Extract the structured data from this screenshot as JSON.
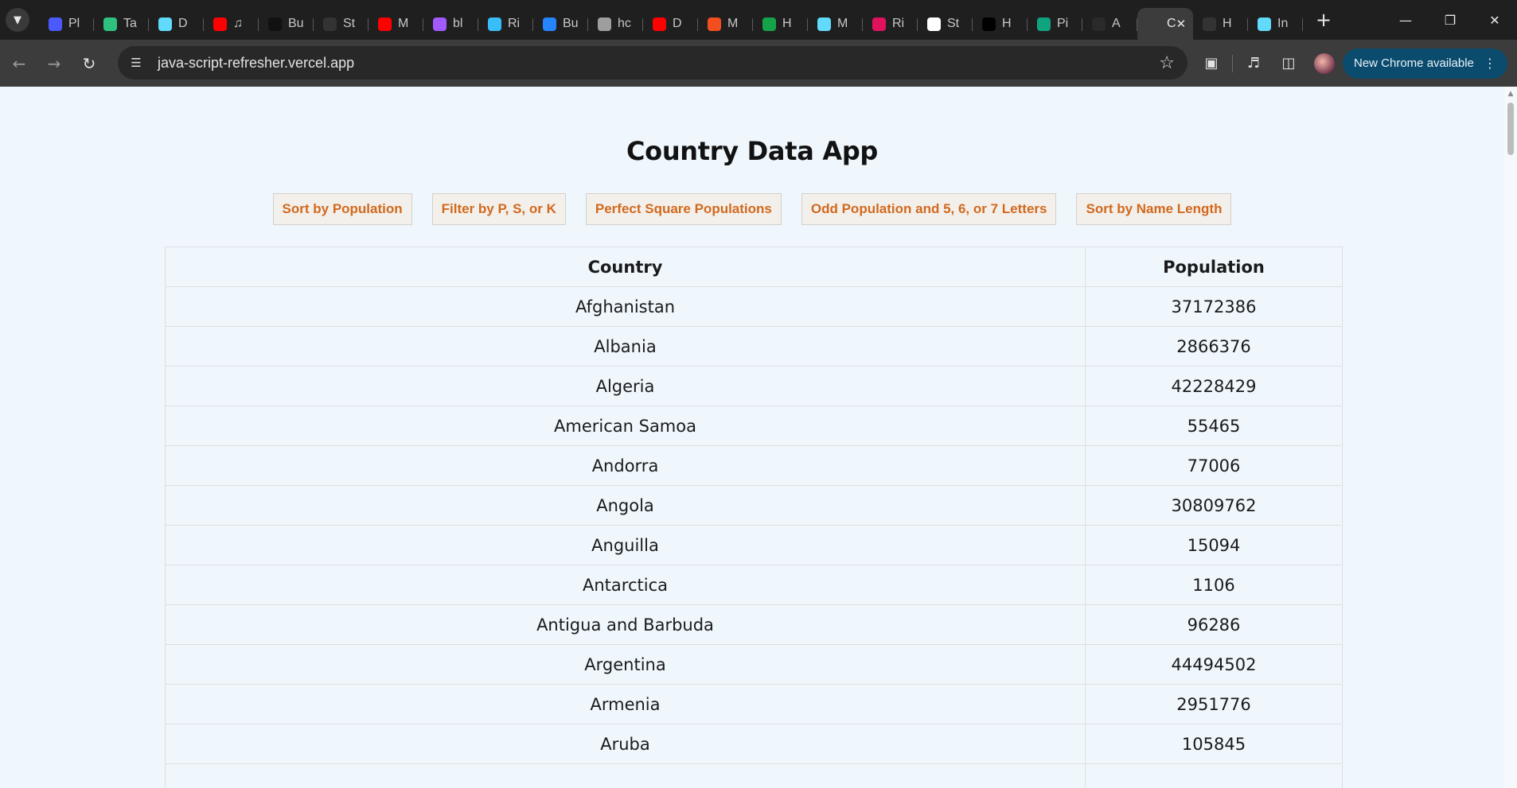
{
  "browser": {
    "tabs": [
      {
        "label": "Pl",
        "icon": "b-circle-icon",
        "color": "#4a5aff"
      },
      {
        "label": "Ta",
        "icon": "leaf-icon",
        "color": "#2ec27e"
      },
      {
        "label": "D",
        "icon": "react-icon",
        "color": "#61dafb"
      },
      {
        "label": "♫",
        "icon": "youtube-icon",
        "color": "#ff0000"
      },
      {
        "label": "Bu",
        "icon": "n-letter-icon",
        "color": "#111111"
      },
      {
        "label": "St",
        "icon": "github-icon",
        "color": "#333333"
      },
      {
        "label": "M",
        "icon": "youtube-icon",
        "color": "#ff0000"
      },
      {
        "label": "bl",
        "icon": "figma-icon",
        "color": "#a259ff"
      },
      {
        "label": "Ri",
        "icon": "tailwind-icon",
        "color": "#38bdf8"
      },
      {
        "label": "Bu",
        "icon": "jira-icon",
        "color": "#2684ff"
      },
      {
        "label": "hc",
        "icon": "calendar-icon",
        "color": "#9e9e9e"
      },
      {
        "label": "D",
        "icon": "youtube-icon",
        "color": "#ff0000"
      },
      {
        "label": "M",
        "icon": "figma-icon",
        "color": "#f24e1e"
      },
      {
        "label": "H",
        "icon": "w-letter-icon",
        "color": "#15a34a"
      },
      {
        "label": "M",
        "icon": "react-icon",
        "color": "#61dafb"
      },
      {
        "label": "Ri",
        "icon": "react-icon",
        "color": "#e0115f"
      },
      {
        "label": "St",
        "icon": "crown-icon",
        "color": "#ffffff"
      },
      {
        "label": "H",
        "icon": "x-logo-icon",
        "color": "#000000"
      },
      {
        "label": "Pi",
        "icon": "chatgpt-icon",
        "color": "#10a37f"
      },
      {
        "label": "A",
        "icon": "chatgpt-icon",
        "color": "#2a2a2a"
      },
      {
        "label": "C",
        "icon": "page-icon",
        "color": "#3c3c3c",
        "active": true
      },
      {
        "label": "H",
        "icon": "github-icon",
        "color": "#333333"
      },
      {
        "label": "In",
        "icon": "react-icon",
        "color": "#61dafb"
      }
    ],
    "url": "java-script-refresher.vercel.app",
    "update_label": "New Chrome available"
  },
  "page": {
    "title": "Country Data App",
    "buttons": [
      {
        "name": "sort-by-population-button",
        "label": "Sort by Population"
      },
      {
        "name": "filter-psk-button",
        "label": "Filter by P, S, or K"
      },
      {
        "name": "perfect-square-button",
        "label": "Perfect Square Populations"
      },
      {
        "name": "odd-population-button",
        "label": "Odd Population and 5, 6, or 7 Letters"
      },
      {
        "name": "sort-by-name-length-button",
        "label": "Sort by Name Length"
      }
    ],
    "table": {
      "headers": [
        "Country",
        "Population"
      ],
      "rows": [
        [
          "Afghanistan",
          "37172386"
        ],
        [
          "Albania",
          "2866376"
        ],
        [
          "Algeria",
          "42228429"
        ],
        [
          "American Samoa",
          "55465"
        ],
        [
          "Andorra",
          "77006"
        ],
        [
          "Angola",
          "30809762"
        ],
        [
          "Anguilla",
          "15094"
        ],
        [
          "Antarctica",
          "1106"
        ],
        [
          "Antigua and Barbuda",
          "96286"
        ],
        [
          "Argentina",
          "44494502"
        ],
        [
          "Armenia",
          "2951776"
        ],
        [
          "Aruba",
          "105845"
        ],
        [
          "",
          ""
        ]
      ]
    }
  },
  "colors": {
    "page_bg": "#eff7fd",
    "button_text": "#d2691e",
    "chrome_dark": "#1f1f1f",
    "toolbar": "#3c3c3c"
  }
}
